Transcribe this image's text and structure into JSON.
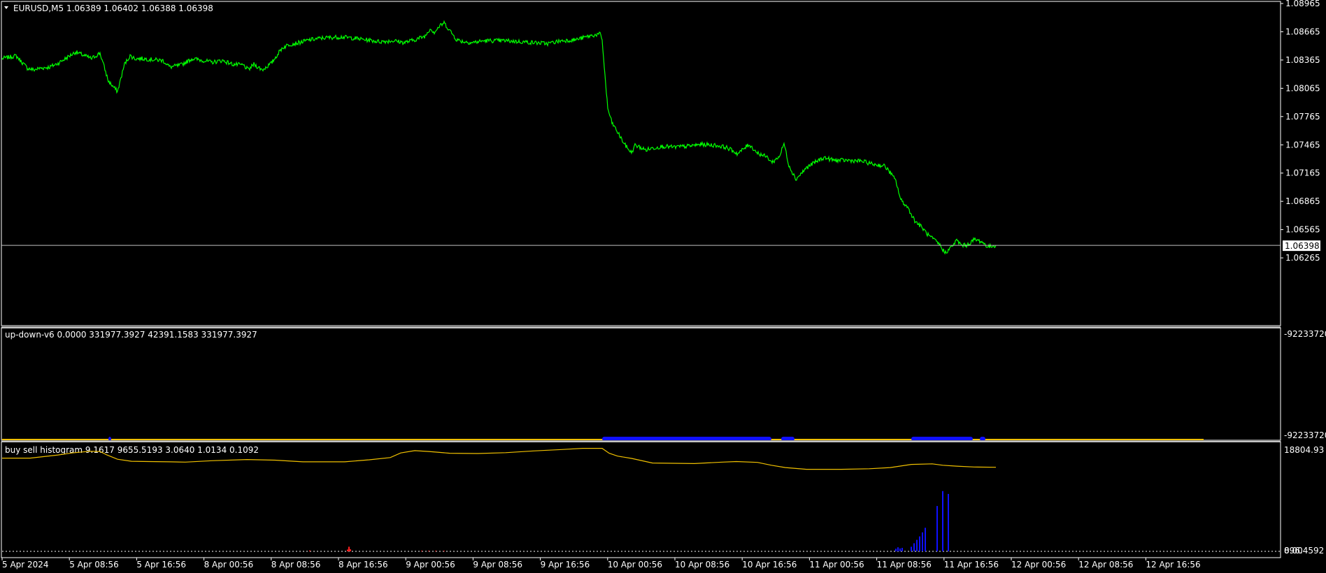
{
  "colors": {
    "background": "#000000",
    "frame": "#ffffff",
    "price_line": "#00ff00",
    "bid_line": "#c0c0c0",
    "indicator_yellow": "#f0c000",
    "indicator_blue": "#1010ff",
    "indicator_red": "#ff2020",
    "separator": "#8a8a8a"
  },
  "main_pane": {
    "title": "EURUSD,M5  1.06389 1.06402 1.06388 1.06398",
    "price_scale": [
      "1.08965",
      "1.08665",
      "1.08365",
      "1.08065",
      "1.07765",
      "1.07465",
      "1.07165",
      "1.06865",
      "1.06565",
      "1.06265"
    ],
    "current_price": "1.06398",
    "collapse_icon": "triangle-down-icon"
  },
  "indicator1": {
    "title": "up-down-v6 0.0000 331977.3927 42391.1583 331977.3927",
    "scale": [
      "-92233720",
      "-92233720"
    ]
  },
  "indicator2": {
    "title": "buy sell histogram 9.1617 9655.5193 3.0640 1.0134 0.1092",
    "scale_top": "18804.93",
    "scale_bottom_a": "0.00",
    "scale_bottom_b": "896.4592"
  },
  "time_axis": [
    "5 Apr 2024",
    "5 Apr 08:56",
    "5 Apr 16:56",
    "8 Apr 00:56",
    "8 Apr 08:56",
    "8 Apr 16:56",
    "9 Apr 00:56",
    "9 Apr 08:56",
    "9 Apr 16:56",
    "10 Apr 00:56",
    "10 Apr 08:56",
    "10 Apr 16:56",
    "11 Apr 00:56",
    "11 Apr 08:56",
    "11 Apr 16:56",
    "12 Apr 00:56",
    "12 Apr 08:56",
    "12 Apr 16:56"
  ],
  "chart_data": {
    "type": "line",
    "symbol": "EURUSD",
    "timeframe": "M5",
    "x_unit": "bar index (M5 bars from 5 Apr 2024 00:56)",
    "ylim": [
      1.0617,
      1.0898
    ],
    "series": [
      {
        "name": "EURUSD",
        "x": [
          0,
          20,
          36,
          45,
          55,
          68,
          80,
          105,
          128,
          140,
          152,
          165,
          175,
          183,
          190,
          200,
          215,
          230,
          240,
          255,
          272,
          288,
          300,
          315,
          330,
          345,
          352,
          360,
          372,
          385,
          400,
          410,
          425,
          440,
          460,
          485,
          500,
          520,
          540,
          560,
          575,
          590,
          605,
          612,
          618,
          625,
          632,
          640,
          650,
          660,
          672,
          690,
          700,
          720,
          740,
          760,
          780,
          800,
          820,
          840,
          855,
          858,
          862,
          866,
          872,
          880,
          890,
          900,
          905,
          912,
          920,
          930,
          945,
          960,
          980,
          1000,
          1020,
          1035,
          1045,
          1052,
          1060,
          1068,
          1080,
          1095,
          1100,
          1105,
          1112,
          1118,
          1125,
          1135,
          1150,
          1160,
          1175,
          1190,
          1210,
          1230,
          1245,
          1262,
          1270,
          1278,
          1285,
          1295,
          1305,
          1315,
          1325,
          1332,
          1340,
          1348,
          1355,
          1365,
          1372,
          1380,
          1390,
          1400,
          1410,
          1421
        ],
        "values": [
          1.0838,
          1.0841,
          1.0828,
          1.0826,
          1.0828,
          1.0829,
          1.0833,
          1.0845,
          1.0838,
          1.0844,
          1.0814,
          1.0803,
          1.0832,
          1.0841,
          1.0838,
          1.0838,
          1.0837,
          1.0836,
          1.0829,
          1.0831,
          1.0838,
          1.0836,
          1.0834,
          1.0836,
          1.0832,
          1.0831,
          1.0826,
          1.0832,
          1.0826,
          1.0833,
          1.0849,
          1.0853,
          1.0855,
          1.0858,
          1.086,
          1.0861,
          1.086,
          1.0858,
          1.0856,
          1.0857,
          1.0855,
          1.0858,
          1.0862,
          1.087,
          1.0866,
          1.0872,
          1.0876,
          1.0868,
          1.0858,
          1.0856,
          1.0855,
          1.0857,
          1.0857,
          1.0857,
          1.0856,
          1.0855,
          1.0854,
          1.0857,
          1.0858,
          1.0862,
          1.0864,
          1.0858,
          1.082,
          1.0785,
          1.077,
          1.076,
          1.0747,
          1.0738,
          1.0746,
          1.0744,
          1.0741,
          1.0743,
          1.0745,
          1.0744,
          1.0745,
          1.0747,
          1.0746,
          1.0744,
          1.074,
          1.0737,
          1.0742,
          1.0747,
          1.0738,
          1.0733,
          1.0728,
          1.073,
          1.0735,
          1.0748,
          1.0725,
          1.071,
          1.0722,
          1.0727,
          1.0733,
          1.073,
          1.073,
          1.0729,
          1.0726,
          1.0724,
          1.0717,
          1.0708,
          1.0688,
          1.068,
          1.0666,
          1.0659,
          1.065,
          1.0646,
          1.0641,
          1.0632,
          1.0636,
          1.0645,
          1.064,
          1.064,
          1.0646,
          1.0644,
          1.0638,
          1.064
        ]
      }
    ],
    "hline": 1.06398
  },
  "histogram_data": {
    "ylim": [
      896.4592,
      18804.93
    ],
    "line_x": [
      0,
      40,
      80,
      100,
      125,
      140,
      150,
      165,
      185,
      210,
      240,
      262,
      300,
      350,
      390,
      430,
      490,
      525,
      555,
      570,
      590,
      610,
      640,
      680,
      720,
      760,
      800,
      830,
      858,
      868,
      880,
      900,
      930,
      960,
      990,
      1030,
      1050,
      1080,
      1100,
      1120,
      1150,
      1200,
      1240,
      1270,
      1300,
      1330,
      1345,
      1365,
      1390,
      1421
    ],
    "line_values": [
      17150,
      17150,
      17700,
      18050,
      18340,
      18300,
      17700,
      16950,
      16600,
      16550,
      16500,
      16450,
      16700,
      16900,
      16800,
      16500,
      16500,
      16850,
      17250,
      18050,
      18450,
      18300,
      18000,
      17950,
      18100,
      18400,
      18650,
      18850,
      18850,
      18000,
      17500,
      17100,
      16300,
      16250,
      16200,
      16450,
      16550,
      16400,
      15900,
      15500,
      15200,
      15200,
      15300,
      15500,
      16050,
      16150,
      15900,
      15750,
      15600,
      15550
    ],
    "blue_bars_x": [
      1278,
      1281,
      1284,
      1287,
      1300,
      1304,
      1308,
      1312,
      1316,
      1320,
      1337,
      1345,
      1353
    ],
    "blue_bars_values": [
      1350,
      1600,
      1400,
      1500,
      1700,
      2300,
      2900,
      3500,
      4200,
      5000,
      8800,
      11400,
      10900
    ],
    "red_marks_x": [
      440,
      494,
      496,
      498,
      600,
      610,
      620,
      632
    ],
    "red_marks_values": [
      1050,
      1200,
      1700,
      1250,
      1000,
      1000,
      1000,
      1000
    ]
  },
  "updown_data": {
    "blue_ranges": [
      [
        152,
        154
      ],
      [
        858,
        1100
      ],
      [
        1114,
        1133
      ],
      [
        1300,
        1388
      ],
      [
        1398,
        1406
      ]
    ]
  }
}
